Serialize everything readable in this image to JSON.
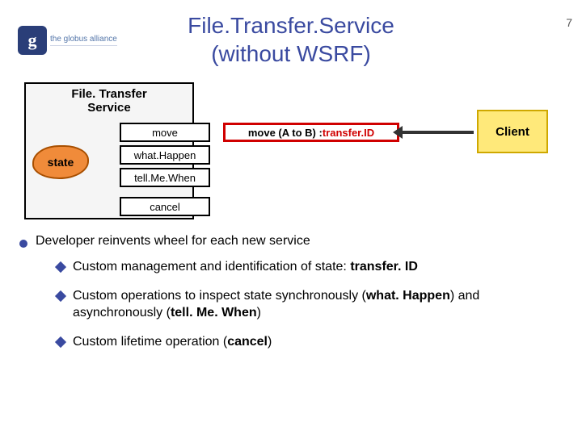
{
  "page_number": "7",
  "logo": {
    "letter": "g",
    "text": "the globus alliance"
  },
  "title_line1": "File.Transfer.Service",
  "title_line2": "(without WSRF)",
  "diagram": {
    "service_label_1": "File. Transfer",
    "service_label_2": "Service",
    "state_label": "state",
    "ops": {
      "move": "move",
      "what": "what.Happen",
      "tell": "tell.Me.When",
      "cancel": "cancel"
    },
    "call_prefix": "move (A to B) : ",
    "call_return": "transfer.ID",
    "client_label": "Client"
  },
  "bullets": {
    "lead": "Developer reinvents wheel for each new service",
    "sub1_a": "Custom management and identification of state: ",
    "sub1_b": "transfer. ID",
    "sub2_a": "Custom operations to inspect state synchronously (",
    "sub2_b": "what. Happen",
    "sub2_c": ") and asynchronously (",
    "sub2_d": "tell. Me. When",
    "sub2_e": ")",
    "sub3_a": "Custom lifetime operation (",
    "sub3_b": "cancel",
    "sub3_c": ")"
  }
}
